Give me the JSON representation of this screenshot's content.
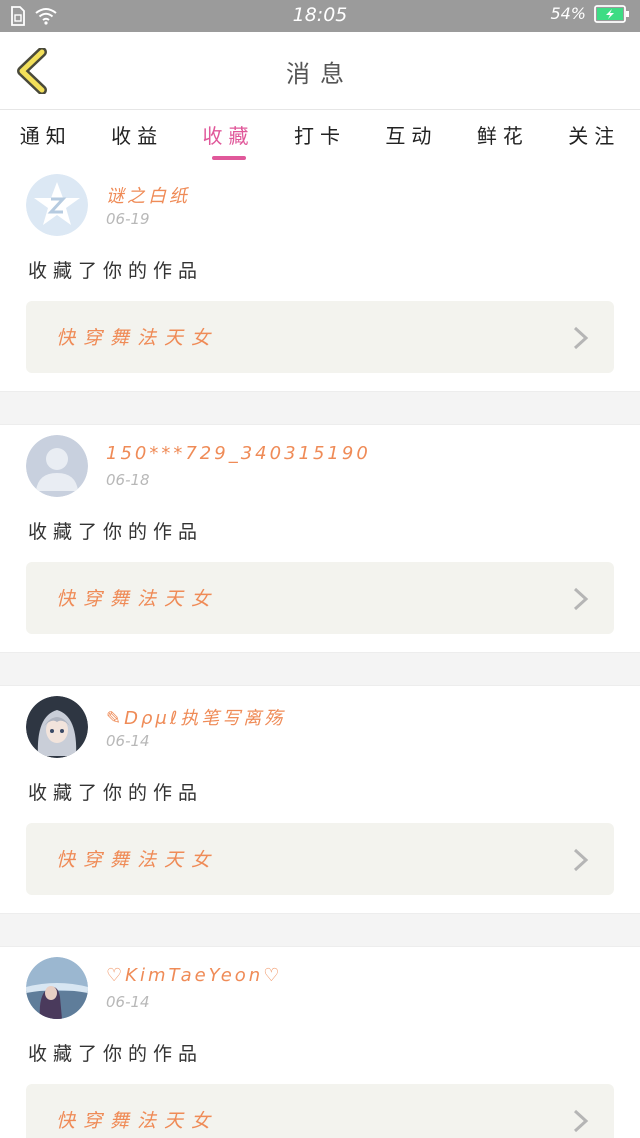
{
  "status_bar": {
    "time": "18:05",
    "battery": "54%",
    "icons": [
      "sim-icon",
      "wifi-icon",
      "battery-icon"
    ]
  },
  "header": {
    "title": "消息",
    "back_icon": "chevron-left-icon"
  },
  "tabs": [
    {
      "label": "通知",
      "active": false
    },
    {
      "label": "收益",
      "active": false
    },
    {
      "label": "收藏",
      "active": true
    },
    {
      "label": "打卡",
      "active": false
    },
    {
      "label": "互动",
      "active": false
    },
    {
      "label": "鲜花",
      "active": false
    },
    {
      "label": "关注",
      "active": false
    }
  ],
  "colors": {
    "accent": "#e0589a",
    "name": "#ef8b57",
    "status_bar": "#9b9b9b",
    "battery": "#3ddc84"
  },
  "messages": [
    {
      "user": "谜之白纸",
      "date": "06-19",
      "action": "收藏了你的作品",
      "work": "快穿舞法天女",
      "avatar": "qq-default-avatar"
    },
    {
      "user": "150***729_340315190",
      "date": "06-18",
      "action": "收藏了你的作品",
      "work": "快穿舞法天女",
      "avatar": "default-user-avatar"
    },
    {
      "user": "✎Dρμℓ执笔写离殇",
      "date": "06-14",
      "action": "收藏了你的作品",
      "work": "快穿舞法天女",
      "avatar": "anime-girl-avatar"
    },
    {
      "user": "♡KimTaeYeon♡",
      "date": "06-14",
      "action": "收藏了你的作品",
      "work": "快穿舞法天女",
      "avatar": "photo-avatar"
    }
  ]
}
